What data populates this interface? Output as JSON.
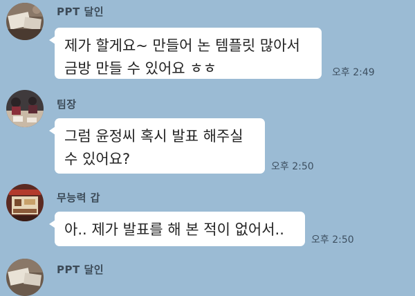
{
  "chat": {
    "background_color": "#9bbbd4",
    "messages": [
      {
        "sender": "PPT 달인",
        "text": "제가 할게요~ 만들어 논 템플릿 많아서\n금방 만들 수 있어요 ㅎㅎ",
        "time": "오후 2:49",
        "avatar_icon": "person-at-desk-avatar"
      },
      {
        "sender": "팀장",
        "text": "그럼 윤정씨 혹시 발표 해주실\n수 있어요?",
        "time": "오후 2:50",
        "avatar_icon": "meeting-table-avatar"
      },
      {
        "sender": "무능력 갑",
        "text": "아.. 제가 발표를 해 본 적이 없어서..",
        "time": "오후 2:50",
        "avatar_icon": "shop-storefront-avatar"
      },
      {
        "sender": "PPT 달인",
        "text": "",
        "time": "",
        "avatar_icon": "person-at-desk-avatar"
      }
    ]
  }
}
